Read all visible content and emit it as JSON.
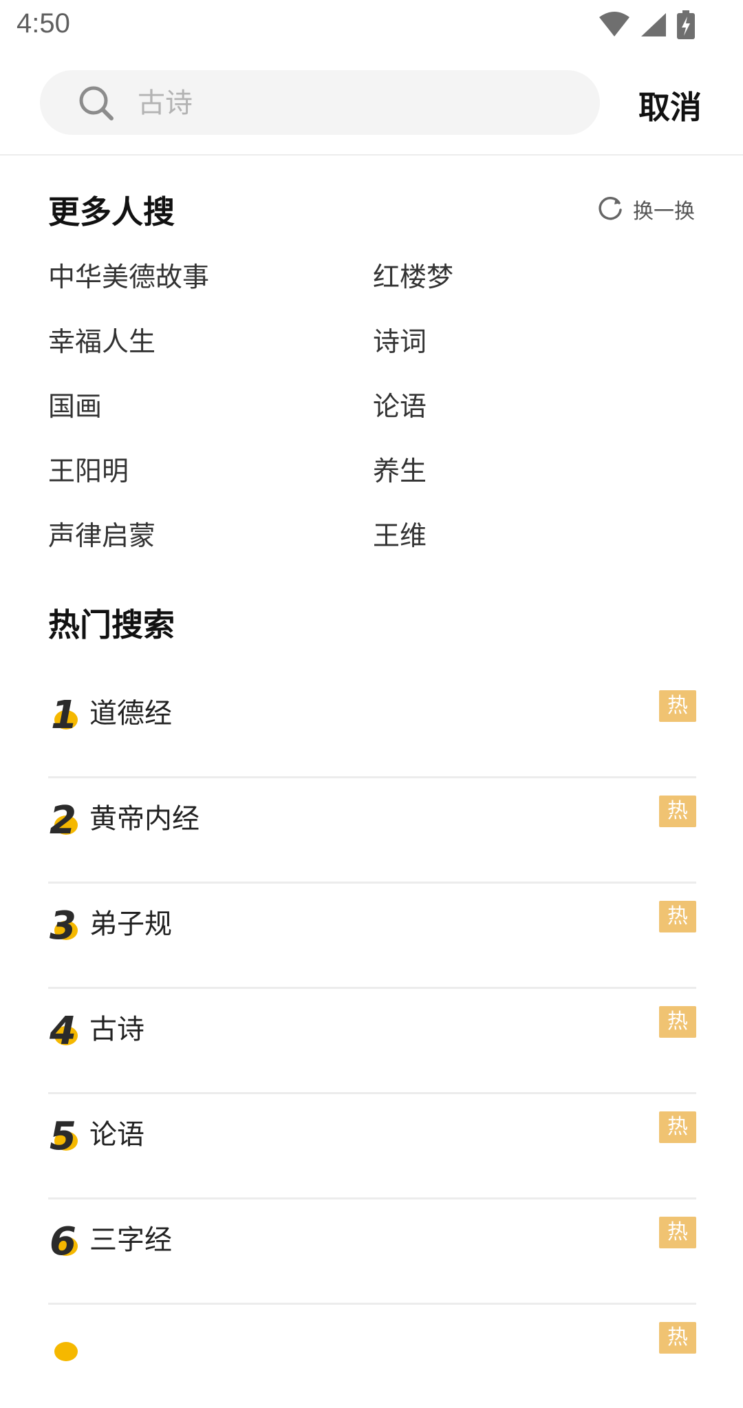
{
  "status_bar": {
    "time": "4:50",
    "icons": [
      "wifi-icon",
      "cell-signal-icon",
      "battery-charging-icon"
    ]
  },
  "search": {
    "placeholder": "古诗",
    "value": "",
    "cancel_label": "取消"
  },
  "more_searches": {
    "title": "更多人搜",
    "refresh_label": "换一换",
    "items": [
      "中华美德故事",
      "红楼梦",
      "幸福人生",
      "诗词",
      "国画",
      "论语",
      "王阳明",
      "养生",
      "声律启蒙",
      "王维"
    ]
  },
  "hot_searches": {
    "title": "热门搜索",
    "badge_label": "热",
    "items": [
      {
        "rank": "1",
        "label": "道德经"
      },
      {
        "rank": "2",
        "label": "黄帝内经"
      },
      {
        "rank": "3",
        "label": "弟子规"
      },
      {
        "rank": "4",
        "label": "古诗"
      },
      {
        "rank": "5",
        "label": "论语"
      },
      {
        "rank": "6",
        "label": "三字经"
      }
    ]
  },
  "colors": {
    "accent": "#f0c372",
    "rank_accent": "#f5b800",
    "rank_dark": "#2b2b2b",
    "search_bg": "#f4f4f4"
  }
}
